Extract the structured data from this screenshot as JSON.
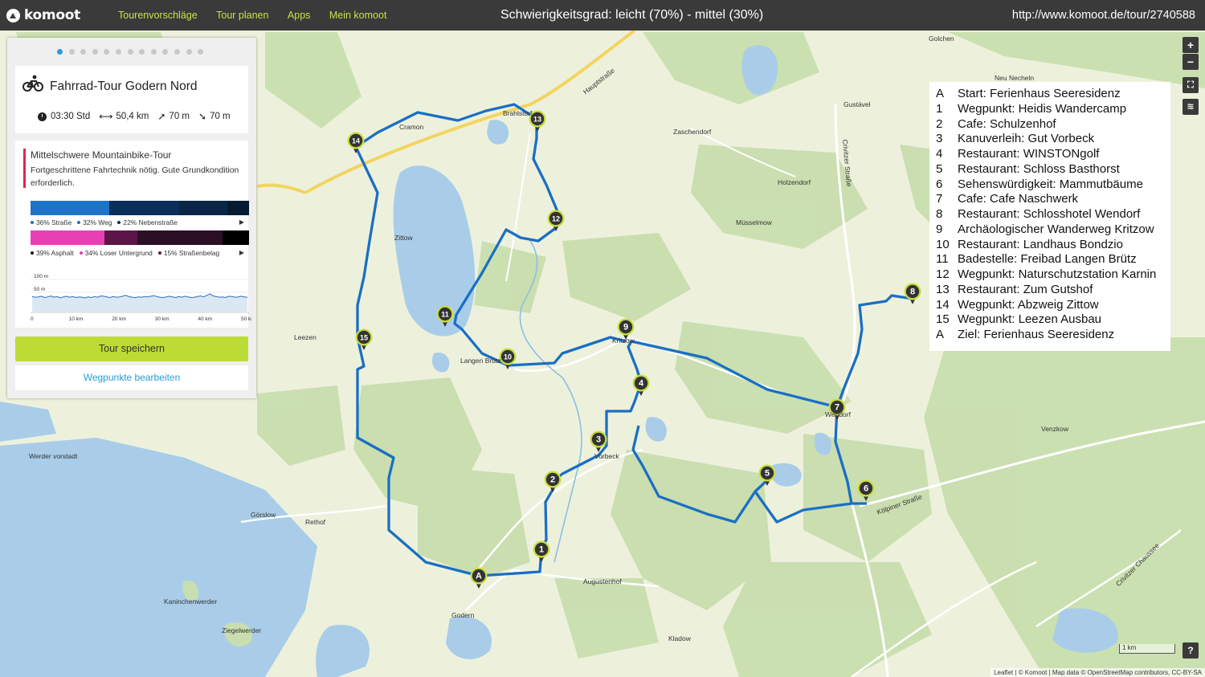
{
  "app": {
    "logo_text": "komoot",
    "nav": [
      "Tourenvorschläge",
      "Tour planen",
      "Apps",
      "Mein komoot"
    ],
    "difficulty_title": "Schwierigkeitsgrad: leicht (70%) - mittel (30%)",
    "url": "http://www.komoot.de/tour/2740588"
  },
  "colors": {
    "accent": "#bcdb34",
    "route": "#1a6fc4",
    "topbar": "#3a3a3a",
    "link": "#2a9bd3"
  },
  "tour": {
    "title": "Fahrrad-Tour Godern Nord",
    "duration": "03:30 Std",
    "distance": "50,4 km",
    "ascent": "70 m",
    "descent": "70 m",
    "carousel_count": 13,
    "carousel_active": 0
  },
  "info": {
    "title": "Mittelschwere Mountainbike-Tour",
    "desc": "Fortgeschrittene Fahrtechnik nötig. Gute Grundkondition erforderlich.",
    "waytypes": {
      "segments": [
        {
          "pct": 36,
          "color": "#1e73c8"
        },
        {
          "pct": 32,
          "color": "#0b2f5a"
        },
        {
          "pct": 22,
          "color": "#0a2647"
        },
        {
          "pct": 10,
          "color": "#061a33"
        }
      ],
      "legend": [
        "36% Straße",
        "32% Weg",
        "22% Nebenstraße"
      ],
      "legend_colors": [
        "#1e73c8",
        "#1e73c8",
        "#0b2f5a"
      ]
    },
    "surfaces": {
      "segments": [
        {
          "pct": 34,
          "color": "#e93fb5"
        },
        {
          "pct": 15,
          "color": "#5c1546"
        },
        {
          "pct": 39,
          "color": "#2a0f25"
        },
        {
          "pct": 12,
          "color": "#000000"
        }
      ],
      "legend": [
        "39% Asphalt",
        "34% Loser Untergrund",
        "15% Straßenbelag"
      ],
      "legend_colors": [
        "#2a0f25",
        "#e93fb5",
        "#5c1546"
      ]
    },
    "elevation": {
      "y_labels": [
        "100 m",
        "50 m"
      ],
      "x_labels": [
        "0",
        "10 km",
        "20 km",
        "30 km",
        "40 km",
        "50 km"
      ],
      "values": [
        48,
        46,
        47,
        49,
        45,
        47,
        50,
        46,
        48,
        44,
        47,
        49,
        46,
        48,
        45,
        47,
        46,
        44,
        47,
        45,
        48,
        46,
        50,
        49,
        47,
        45,
        48,
        46,
        47,
        49,
        52,
        48,
        46,
        45,
        47,
        46,
        48,
        47,
        49,
        51,
        48,
        46,
        45,
        47,
        49,
        47,
        45,
        48,
        46,
        49,
        47,
        45,
        46,
        48,
        50,
        47,
        52,
        56,
        50,
        48,
        46,
        47,
        45,
        49,
        48,
        46,
        47,
        49,
        47,
        46
      ]
    },
    "save_label": "Tour speichern",
    "edit_label": "Wegpunkte bearbeiten"
  },
  "waypoints": [
    {
      "key": "A",
      "label": "Start: Ferienhaus Seeresidenz"
    },
    {
      "key": "1",
      "label": "Wegpunkt: Heidis Wandercamp"
    },
    {
      "key": "2",
      "label": "Cafe: Schulzenhof"
    },
    {
      "key": "3",
      "label": "Kanuverleih: Gut Vorbeck"
    },
    {
      "key": "4",
      "label": "Restaurant: WINSTONgolf"
    },
    {
      "key": "5",
      "label": "Restaurant: Schloss Basthorst"
    },
    {
      "key": "6",
      "label": "Sehenswürdigkeit: Mammutbäume"
    },
    {
      "key": "7",
      "label": "Cafe: Cafe Naschwerk"
    },
    {
      "key": "8",
      "label": "Restaurant: Schlosshotel Wendorf"
    },
    {
      "key": "9",
      "label": "Archäologischer Wanderweg Kritzow"
    },
    {
      "key": "10",
      "label": "Restaurant: Landhaus Bondzio"
    },
    {
      "key": "11",
      "label": "Badestelle: Freibad Langen Brütz"
    },
    {
      "key": "12",
      "label": "Wegpunkt: Naturschutzstation Karnin"
    },
    {
      "key": "13",
      "label": "Restaurant: Zum Gutshof"
    },
    {
      "key": "14",
      "label": "Wegpunkt: Abzweig Zittow"
    },
    {
      "key": "15",
      "label": "Wegpunkt: Leezen Ausbau"
    },
    {
      "key": "A",
      "label": "Ziel: Ferienhaus Seeresidenz"
    }
  ],
  "map_labels": [
    "Golchen",
    "Neu Necheln",
    "Gustävel",
    "Zaschendorf",
    "Holzendorf",
    "Müsselmow",
    "Cramon",
    "Brahlstorf",
    "Zittow",
    "Leezen",
    "Langen Brütz",
    "Kritzow",
    "Wendorf",
    "Vorbeck",
    "Venzkow",
    "Görslow",
    "Rethof",
    "Werder vorstadt",
    "Augustenhof",
    "Godern",
    "Kaninchenwerder",
    "Ziegelwerder",
    "Kladow",
    "Hauptstraße",
    "Crivitzer Straße",
    "Kölpiner Straße",
    "Crivitzer Chaussee"
  ],
  "map_controls": {
    "zoom_in": "+",
    "zoom_out": "−",
    "help": "?",
    "scale": "1 km"
  },
  "attribution": "Leaflet | © Komoot | Map data © OpenStreetMap contributors, CC-BY-SA"
}
